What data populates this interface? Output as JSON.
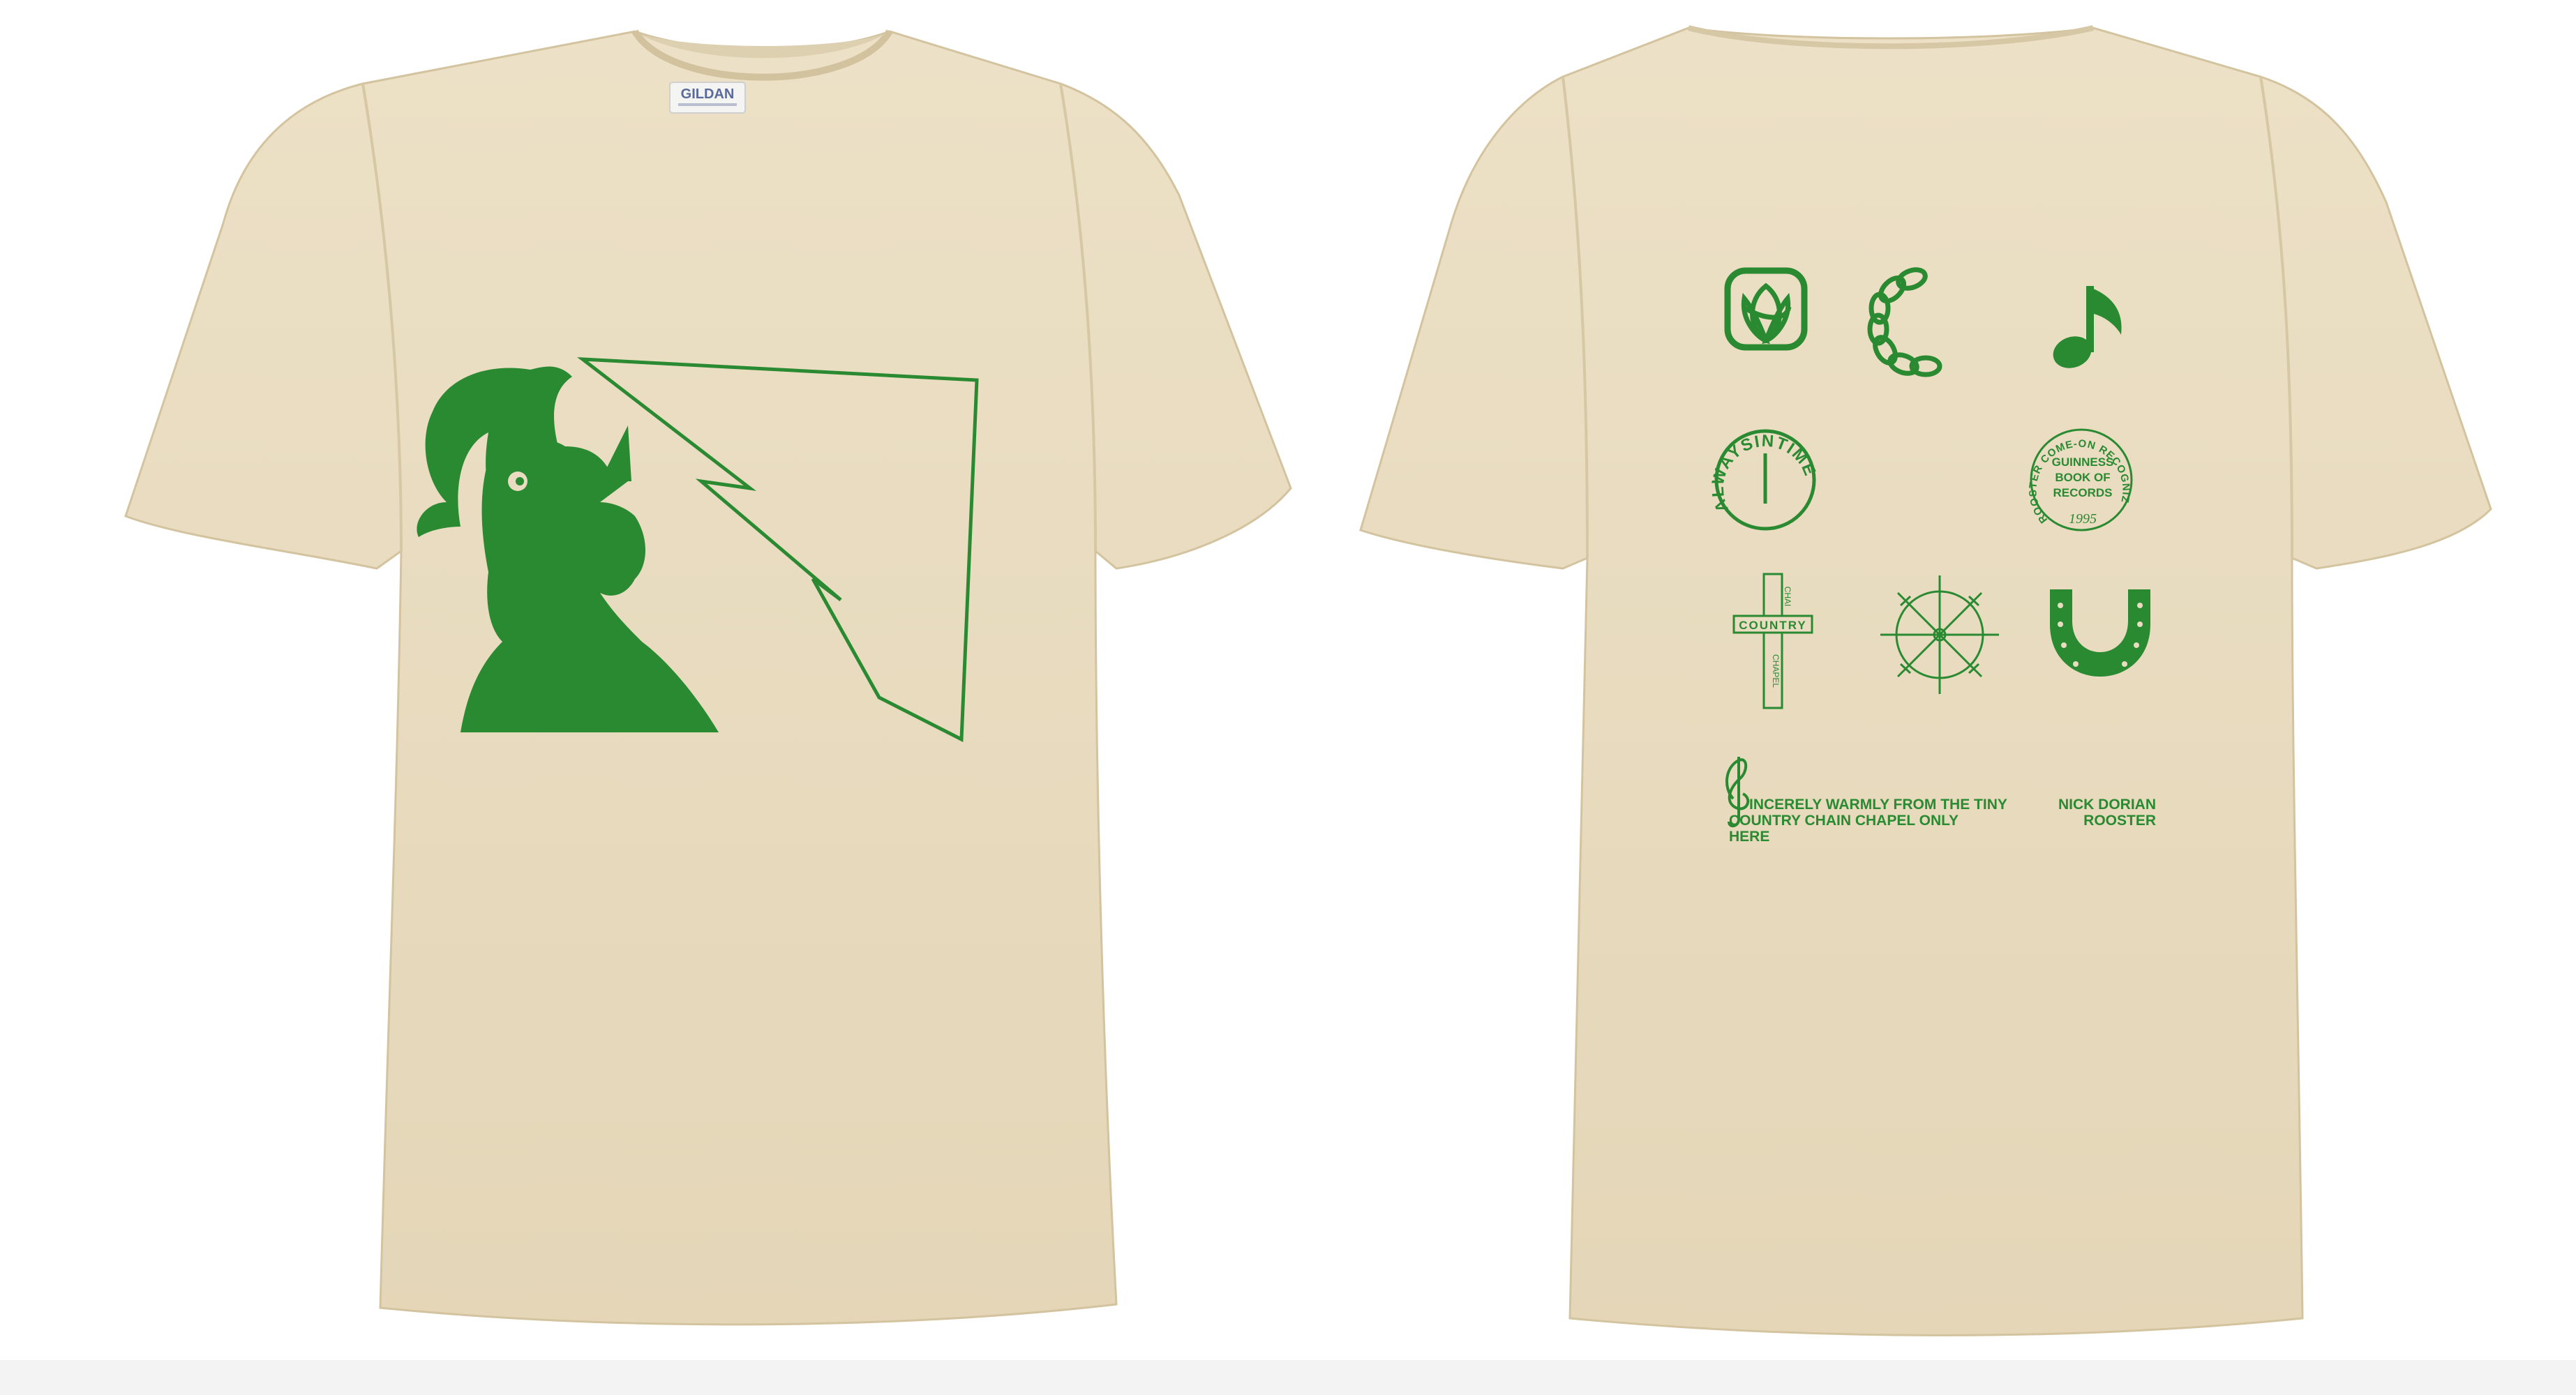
{
  "colors": {
    "shirt": "#e9dcc0",
    "shirt_shadow": "#d8c9a8",
    "ink": "#2a8a32",
    "label_bg": "#f4f4f2",
    "label_text": "#5a6a9a",
    "background": "#ffffff"
  },
  "front": {
    "label_brand": "GILDAN",
    "design": "rooster-crowing-with-lightning-triangle"
  },
  "back": {
    "icons": [
      "trillium-square-icon",
      "chain-c-icon",
      "music-note-icon",
      "clock-always-in-time-icon",
      "guinness-record-seal-icon",
      "country-chain-chapel-cross-icon",
      "sun-wheel-icon",
      "horseshoe-icon"
    ],
    "clock_text": "ALWAYSINTIME",
    "seal_outer": "ROOSTER COME-ON RECOGNIZED BY",
    "seal_line1": "GUINNESS",
    "seal_line2": "BOOK OF",
    "seal_line3": "RECORDS",
    "seal_year": "1995",
    "cross_horizontal": "COUNTRY",
    "cross_top": "CHAI",
    "cross_bottom": "CHAPEL",
    "text_line1": "INCERELY WARMLY FROM THE TINY",
    "text_line2": "COUNTRY CHAIN CHAPEL ONLY",
    "text_line3": "HERE",
    "signature_line1": "NICK DORIAN",
    "signature_line2": "ROOSTER"
  }
}
